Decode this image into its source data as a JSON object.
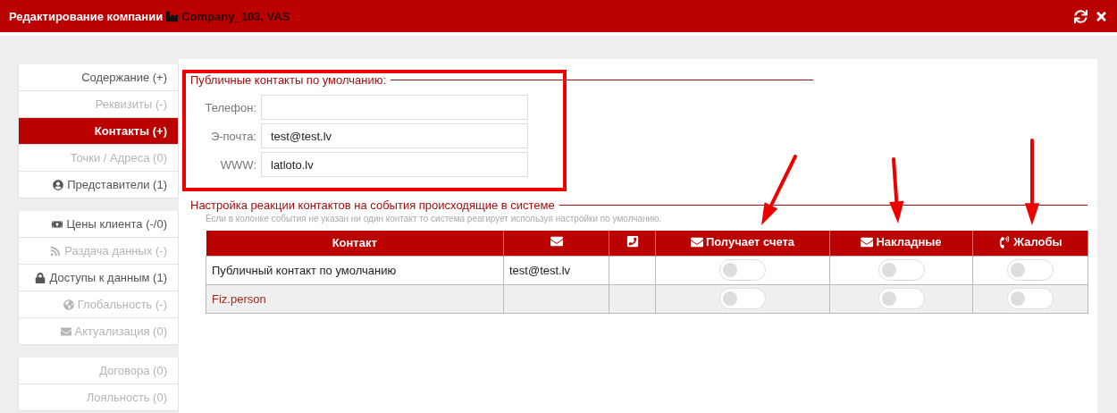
{
  "window": {
    "title": "Редактирование компании",
    "company": "Company_103, VAS"
  },
  "sidebar": {
    "groups": [
      {
        "items": [
          {
            "label": "Содержание (+)",
            "selected": false,
            "disabled": false
          },
          {
            "label": "Реквизиты (-)",
            "selected": false,
            "disabled": true
          },
          {
            "label": "Контакты (+)",
            "selected": true,
            "disabled": false
          },
          {
            "label": "Точки / Адреса (0)",
            "selected": false,
            "disabled": true
          },
          {
            "label": "Представители (1)",
            "selected": false,
            "disabled": false
          }
        ]
      },
      {
        "items": [
          {
            "label": "Цены клиента (-/0)",
            "selected": false,
            "disabled": false
          },
          {
            "label": "Раздача данных (-)",
            "selected": false,
            "disabled": true
          },
          {
            "label": "Доступы к данным (1)",
            "selected": false,
            "disabled": false
          },
          {
            "label": "Глобальность (-)",
            "selected": false,
            "disabled": true
          },
          {
            "label": "Актуализация (0)",
            "selected": false,
            "disabled": true
          }
        ]
      },
      {
        "items": [
          {
            "label": "Договора (0)",
            "selected": false,
            "disabled": true
          },
          {
            "label": "Лояльность (0)",
            "selected": false,
            "disabled": true
          }
        ]
      }
    ]
  },
  "public_contacts": {
    "title": "Публичные контакты по умолчанию:",
    "fields": [
      {
        "label": "Телефон:"
      },
      {
        "label": "Э-почта:",
        "value": "test@test.lv"
      },
      {
        "label": "WWW:",
        "value": "latloto.lv"
      }
    ]
  },
  "reactions": {
    "title": "Настройка реакции контактов на события происходящие в системе",
    "hint": "Если в колонке события не указан ни один контакт то система реагирует используя настройки по умолчанию.",
    "table": {
      "columns": [
        {
          "label": "Контакт"
        },
        {},
        {},
        {
          "label": "Получает счета"
        },
        {
          "label": "Накладные"
        },
        {
          "label": "Жалобы"
        }
      ],
      "rows": [
        {
          "name": "Публичный контакт по умолчанию",
          "link": false,
          "email": "test@test.lv",
          "toggles": [
            {
              "on": false
            },
            {
              "on": false
            },
            {
              "on": false
            }
          ]
        },
        {
          "name": "Fiz.person",
          "link": true,
          "toggles": [
            {
              "on": false
            },
            {
              "on": false
            },
            {
              "on": false
            }
          ]
        }
      ]
    }
  }
}
